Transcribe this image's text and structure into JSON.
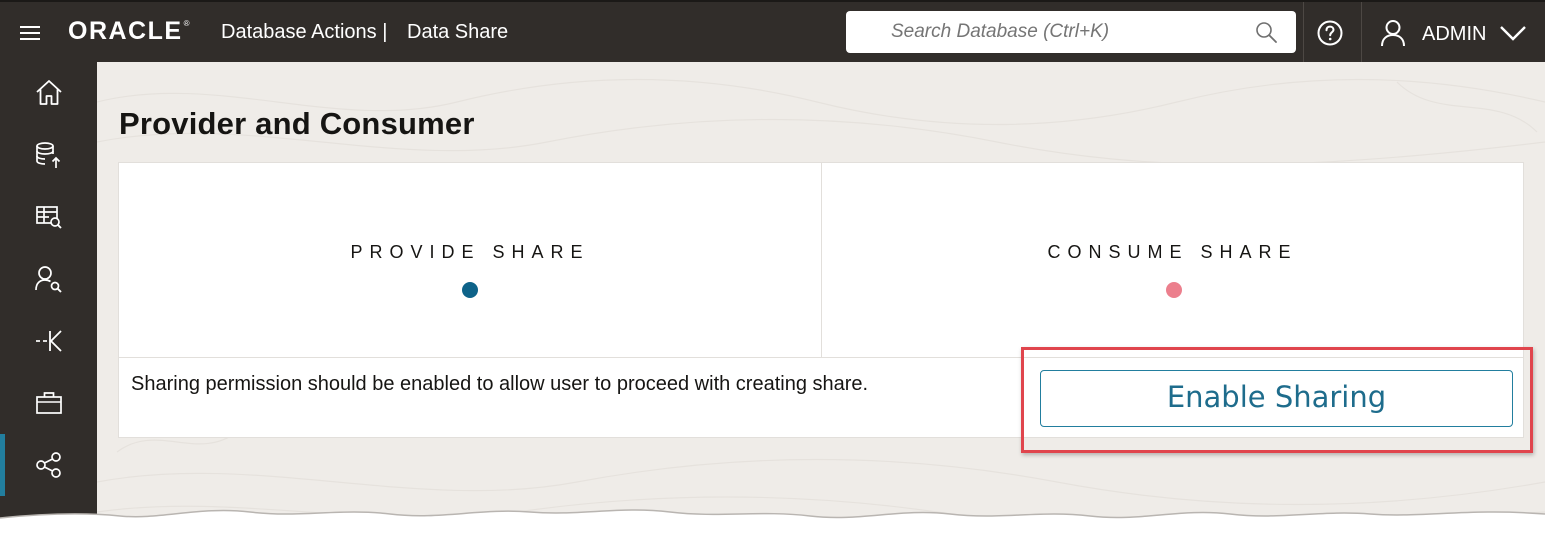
{
  "header": {
    "menu_label": "",
    "logo_text": "ORACLE",
    "logo_mark": "®",
    "app_title": "Database Actions |",
    "page_crumb": "Data Share",
    "search_placeholder": "Search Database (Ctrl+K)",
    "user_name": "ADMIN"
  },
  "sidebar": {
    "items": [
      {
        "name": "home",
        "icon": "home-icon"
      },
      {
        "name": "data-load",
        "icon": "database-upload-icon"
      },
      {
        "name": "catalog",
        "icon": "table-search-icon"
      },
      {
        "name": "data-insights",
        "icon": "user-search-icon"
      },
      {
        "name": "data-transforms",
        "icon": "transforms-icon"
      },
      {
        "name": "business-models",
        "icon": "briefcase-icon"
      },
      {
        "name": "data-share",
        "icon": "share-nodes-icon"
      }
    ],
    "active_index": 6
  },
  "main": {
    "title": "Provider and Consumer",
    "provide_card": {
      "title": "PROVIDE SHARE",
      "dot_color": "#0e6389"
    },
    "consume_card": {
      "title": "CONSUME SHARE",
      "dot_color": "#ec7f8d"
    },
    "info_text": "Sharing permission should be enabled to allow user to proceed with creating share.",
    "enable_button": "Enable Sharing"
  },
  "colors": {
    "header_bg": "#312d2a",
    "accent": "#227e9e",
    "highlight": "#e0454d"
  }
}
